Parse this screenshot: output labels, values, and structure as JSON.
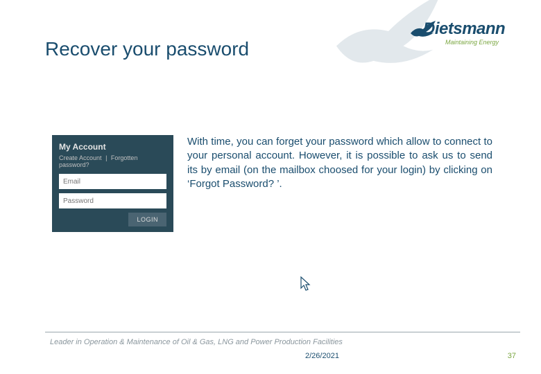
{
  "brand": {
    "name": "Dietsmann",
    "tagline": "Maintaining Energy"
  },
  "title": "Recover your password",
  "login_widget": {
    "heading": "My Account",
    "create_link": "Create Account",
    "forgot_link": "Forgotten password?",
    "email_placeholder": "Email",
    "password_placeholder": "Password",
    "button_label": "LOGIN"
  },
  "body_text": "With time, you can forget your password which allow to connect to your personal account. However, it is possible to ask us to send its by email (on the mailbox choosed for your login) by clicking on ‘Forgot Password? ’.",
  "footer": {
    "tagline": "Leader in Operation & Maintenance of Oil & Gas, LNG and Power Production Facilities",
    "date": "2/26/2021",
    "page": "37"
  }
}
